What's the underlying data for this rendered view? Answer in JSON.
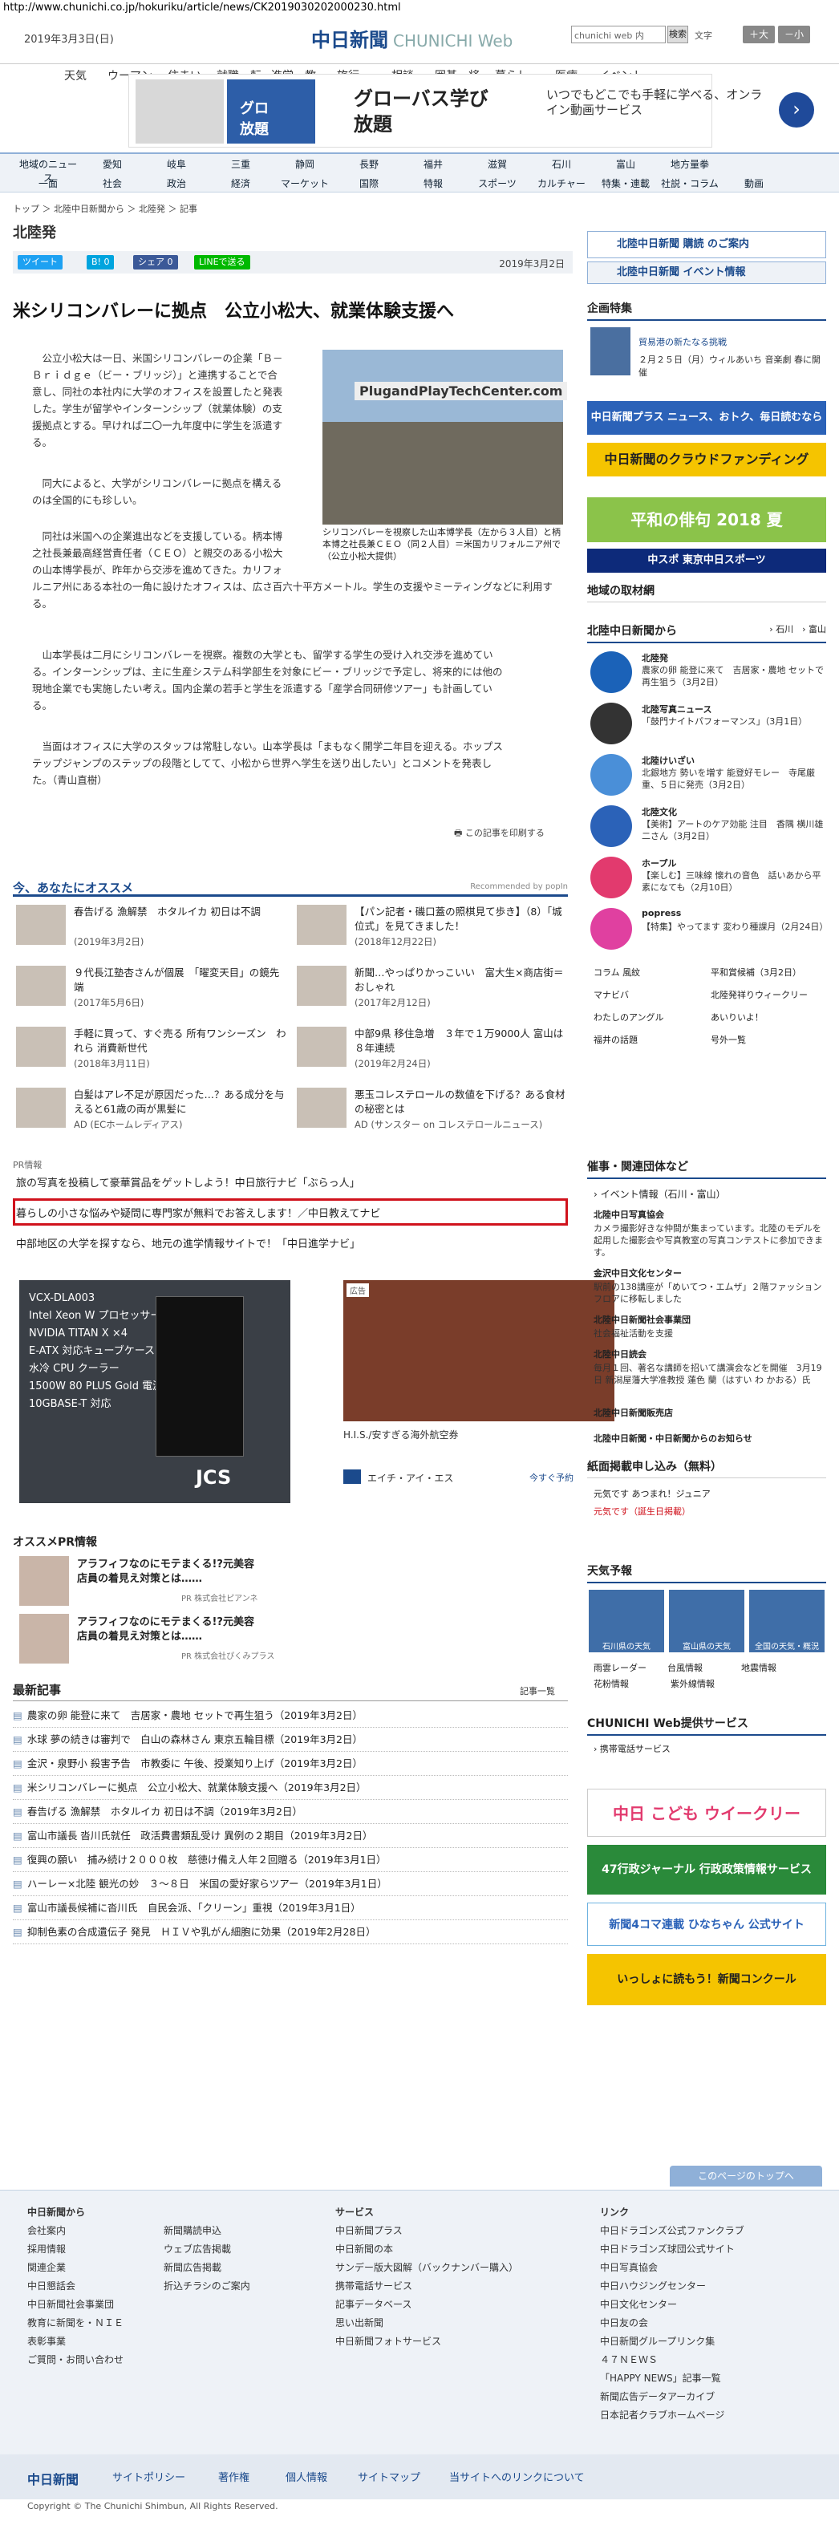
{
  "url": "http://www.chunichi.co.jp/hokuriku/article/news/CK2019030202000230.html",
  "header": {
    "date": "2019年3月3日(日)",
    "logo": "中日新聞",
    "logo_sub": "CHUNICHI Web",
    "search_placeholder": "chunichi web 内",
    "search_btn": "検索",
    "font_label": "文字",
    "font_big": "＋大",
    "font_small": "－小"
  },
  "gnav": [
    "天気",
    "ウーマン",
    "住まい",
    "就職・転職",
    "進学・教育",
    "旅行",
    "相談",
    "囲碁・将棋",
    "暮らし",
    "医療",
    "イベント"
  ],
  "ad1": {
    "title": "グローバス学び\n放題",
    "text": "いつでもどこでも手軽に学べる、オンライン動画サービス",
    "arrow": "›",
    "logo": "グロ\n放題"
  },
  "nav2": {
    "row1": [
      "地域のニュース",
      "愛知",
      "岐阜",
      "三重",
      "静岡",
      "長野",
      "福井",
      "滋賀",
      "石川",
      "富山",
      "地方量拳"
    ],
    "row2": [
      "一面",
      "社会",
      "政治",
      "経済",
      "マーケット",
      "国際",
      "特報",
      "スポーツ",
      "カルチャー",
      "特集・連載",
      "社説・コラム",
      "動画"
    ]
  },
  "crumb": "トップ ＞ 北陸中日新聞から ＞ 北陸発 ＞ 記事",
  "page_title": "北陸発",
  "share": {
    "tweet": "ツイート",
    "hatena": "B! 0",
    "fb": "シェア 0",
    "line": "LINEで送る",
    "date": "2019年3月2日"
  },
  "article": {
    "headline": "米シリコンバレーに拠点　公立小松大、就業体験支援へ",
    "p1": [
      "　公立小松大は一日、米国シリコンバレーの企業「Ｂ－",
      "Ｂｒｉｄｇｅ（ビー・ブリッジ）」と連携することで合",
      "意し、同社の本社内に大学のオフィスを設置したと発表",
      "した。学生が留学やインターンシップ（就業体験）の支",
      "援拠点とする。早ければ二〇一九年度中に学生を派遣す",
      "る。"
    ],
    "p2": [
      "　同大によると、大学がシリコンバレーに拠点を構える",
      "のは全国的にも珍しい。"
    ],
    "p3": [
      "　同社は米国への企業進出などを支援している。柄本博",
      "之社長兼最高経営責任者（ＣＥＯ）と親交のある小松大",
      "の山本博学長が、昨年から交渉を進めてきた。カリフォ",
      "ルニア州にある本社の一角に設けたオフィスは、広さ百六十平方メートル。学生の支援やミーティングなどに利用する。"
    ],
    "p4": [
      "　山本学長は二月にシリコンバレーを視察。複数の大学とも、留学する学生の受け入れ交渉を進めてい",
      "る。インターンシップは、主に生産システム科学部生を対象にビー・ブリッジで予定し、将来的には他の",
      "現地企業でも実施したい考え。国内企業の若手と学生を派遣する「産学合同研修ツアー」も計画してい",
      "る。"
    ],
    "p5": [
      "　当面はオフィスに大学のスタッフは常駐しない。山本学長は「まもなく開学二年目を迎える。ホップス",
      "テップジャンプのステップの段階としてて、小松から世界へ学生を送り出したい」とコメントを発表し",
      "た。（青山直樹）"
    ],
    "photo_sign": "PlugandPlayTechCenter.com",
    "caption": "シリコンバレーを視察した山本博学長（左から３人目）と柄本博之社長兼ＣＥＯ（同２人目）＝米国カリフォルニア州で（公立小松大提供）",
    "print": "この記事を印刷する"
  },
  "recommend": {
    "title": "今、あなたにオススメ",
    "by": "Recommended by popIn",
    "items": [
      {
        "t": "春告げる 漁解禁　ホタルイカ 初日は不調",
        "d": "(2019年3月2日)"
      },
      {
        "t": "【パン記者・磯口蓋の照棋見て歩き】（8）「城位式」を見てきました！",
        "d": "(2018年12月22日)"
      },
      {
        "t": "９代長江塾杏さんが個展　「曜変天目」の鏡先端",
        "d": "(2017年5月6日)"
      },
      {
        "t": "新聞…やっぱりかっこいい　富大生×商店街＝おしゃれ",
        "d": "(2017年2月12日)"
      },
      {
        "t": "手軽に買って、すぐ売る 所有ワンシーズン　われら 消費新世代",
        "d": "(2018年3月11日)"
      },
      {
        "t": "中部9県 移住急増　３年で１万9000人 富山は８年連続",
        "d": "(2019年2月24日)"
      },
      {
        "t": "白髪はアレ不足が原因だった…？ある成分を与えると61歳の両が黒髪に",
        "d": "AD (ECホームレディアス)"
      },
      {
        "t": "悪玉コレステロールの数値を下げる？ある食材の秘密とは",
        "d": "AD (サンスター on コレステロールニュース)"
      }
    ]
  },
  "pr": {
    "label": "PR情報",
    "lines": [
      "旅の写真を投稿して豪華賞品をゲットしよう！中日旅行ナビ「ぶらっ人」",
      "暮らしの小さな悩みや疑問に専門家が無料でお答えします！／中日教えてナビ",
      "中部地区の大学を探すなら、地元の進学情報サイトで！「中日進学ナビ」"
    ]
  },
  "ads": {
    "left_lines": [
      "VCX-DLA003",
      "Intel Xeon W プロセッサー",
      "NVIDIA TITAN X ×4",
      "E-ATX 対応キューブケース",
      "水冷 CPU クーラー",
      "1500W 80 PLUS Gold 電源",
      "10GBASE-T 対応"
    ],
    "left_brand": "JCS",
    "right_badge": "広告",
    "right_caption": "H.I.S./安すぎる海外航空券",
    "right_brand": "エイチ・アイ・エス",
    "right_link": "今すぐ予約"
  },
  "osusume": {
    "title": "オススメPR情報",
    "items": [
      {
        "t": "アラフィフなのにモテまくる!?元美容店員の着見え対策とは……",
        "s": "PR 株式会社ピアンネ"
      },
      {
        "t": "アラフィフなのにモテまくる!?元美容店員の着見え対策とは……",
        "s": "PR 株式会社ぴくみプラス"
      }
    ]
  },
  "latest": {
    "title": "最新記事",
    "more": "記事一覧",
    "items": [
      "農家の卵 能登に来て　吉居家・農地 セットで再生狙う（2019年3月2日）",
      "水球 夢の続きは審判で　白山の森林さん 東京五輪目標（2019年3月2日）",
      "金沢・泉野小 殺害予告　市教委に 午後、授業知り上げ（2019年3月2日）",
      "米シリコンバレーに拠点　公立小松大、就業体験支援へ（2019年3月2日）",
      "春告げる 漁解禁　ホタルイカ 初日は不調（2019年3月2日）",
      "富山市議長 沓川氏就任　政活費書類乱受け 異例の２期目（2019年3月2日）",
      "復興の願い　捕み続け２０００枚　慈徳け備え人年２回贈る（2019年3月1日）",
      "ハーレー×北陸 観光の妙　３〜８日　米国の愛好家らツアー（2019年3月1日）",
      "富山市議長候補に沓川氏　自民会派、「クリーン」重視（2019年3月1日）",
      "抑制色素の合成遺伝子 発見　ＨＩＶや乳がん細胞に効果（2019年2月28日）"
    ]
  },
  "side": {
    "sub1": "北陸中日新聞 購読 のご案内",
    "sub2": "北陸中日新聞 イベント情報",
    "kikaku": "企画特集",
    "kikaku_item": "貿易港の新たなる挑戦",
    "kikaku_text": "２月２５日（月）ウィルあいち 音楽劇 春に開催",
    "banners": [
      "中日新聞プラス ニュース、おトク、毎日読むならぜんぶ",
      "中日新聞のクラウドファンディング",
      "平和の俳句 2018 夏",
      "中スポ 東京中日スポーツ"
    ],
    "local": "地域の取材網",
    "hokuriku": {
      "title": "北陸中日新聞から",
      "links": [
        "石川",
        "富山"
      ],
      "items": [
        {
          "n": "北陸発",
          "t": "農家の卵 能登に来て　吉居家・農地 セットで再生狙う（3月2日）"
        },
        {
          "n": "北陸写真ニュース",
          "t": "「鼓門ナイトパフォーマンス」（3月1日）"
        },
        {
          "n": "北陸けいざい",
          "t": "北銀地方 勢いを増す 能登好モレー　寺尾厳重、５日に発売（3月2日）"
        },
        {
          "n": "北陸文化",
          "t": "【美術】アートのケア効能 注目　香隅 横川雄二さん（3月2日）"
        },
        {
          "n": "ホープル",
          "t": "【楽しむ】三味線 懐れの音色　話いあから平素になても（2月10日）"
        },
        {
          "n": "popress",
          "t": "【特集】やってます 変わり種課月（2月24日）"
        }
      ]
    },
    "columns": [
      "コラム 風紋",
      "平和賞候補（3月2日）",
      "マナビバ",
      "北陸発祥りウィークリー",
      "わたしのアングル",
      "あいりいよ！",
      "福井の話題",
      "号外一覧"
    ],
    "group": "催事・関連団体など",
    "event": "イベント情報（石川・富山）",
    "groupitems": [
      {
        "n": "北陸中日写真協会",
        "t": "カメラ撮影好きな仲間が集まっています。北陸のモデルを起用した撮影会や写真教室の写真コンテストに参加できます。"
      },
      {
        "n": "金沢中日文化センター",
        "t": "駅前の138講座が「めいてつ・エムザ」２階ファッションフロアに移転しました"
      },
      {
        "n": "北陸中日新聞社会事業団",
        "t": "社会福祉活動を支援"
      },
      {
        "n": "北陸中日読会",
        "t": "毎月１回、著名な講師を招いて講演会などを開催　3月19日 新潟屋藩大学准教授 蓮色 蘭（はすい わ かおる）氏"
      },
      {
        "n": "北陸中日新聞販売店",
        "t": ""
      },
      {
        "n": "北陸中日新聞・中日新聞からのお知らせ",
        "t": ""
      }
    ],
    "paper": "紙面掲載申し込み（無料）",
    "paper_items": [
      "元気です あつまれ！ジュニア",
      "元気です（誕生日掲載）"
    ],
    "weather": "天気予報",
    "weather_items": [
      "石川県の天気",
      "富山県の天気",
      "全国の天気・概況"
    ],
    "weather_links": [
      "雨雲レーダー",
      "台風情報",
      "地震情報",
      "花粉情報",
      "紫外線情報"
    ],
    "service": "CHUNICHI Web提供サービス",
    "service_items": [
      "携帯電話サービス"
    ],
    "sbanners": [
      "中日 こども ウイークリー",
      "47行政ジャーナル 行政政策情報サービス",
      "新聞4コマ連載 ひなちゃん 公式サイト",
      "いっしょに読もう！新聞コンクール"
    ]
  },
  "totop": "このページのトップへ",
  "footer": {
    "c1": [
      "中日新聞から",
      "会社案内",
      "採用情報",
      "関連企業",
      "中日懇話会",
      "中日新聞社会事業団",
      "教育に新聞を・ＮＩＥ",
      "表彰事業",
      "ご質問・お問い合わせ"
    ],
    "c2": [
      "新聞購読申込",
      "ウェブ広告掲載",
      "新聞広告掲載",
      "折込チラシのご案内"
    ],
    "c3": [
      "サービス",
      "中日新聞プラス",
      "中日新聞の本",
      "サンデー版大図解（バックナンバー購入）",
      "携帯電話サービス",
      "記事データベース",
      "思い出新聞",
      "中日新聞フォトサービス"
    ],
    "c4": [
      "リンク",
      "中日ドラゴンズ公式ファンクラブ",
      "中日ドラゴンズ球団公式サイト",
      "中日写真協会",
      "中日ハウジングセンター",
      "中日文化センター",
      "中日友の会",
      "中日新聞グループリンク集",
      "４７ＮＥＷＳ",
      "「HAPPY NEWS」記事一覧",
      "新聞広告データアーカイブ",
      "日本記者クラブホームページ"
    ]
  },
  "fbar": [
    "中日新聞",
    "サイトポリシー",
    "著作権",
    "個人情報",
    "サイトマップ",
    "当サイトへのリンクについて"
  ],
  "copyright": "Copyright © The Chunichi Shimbun, All Rights Reserved.",
  "colors": {
    "brand": "#1b4a8c",
    "red": "#d0121c",
    "nav": "#eef2f7"
  }
}
